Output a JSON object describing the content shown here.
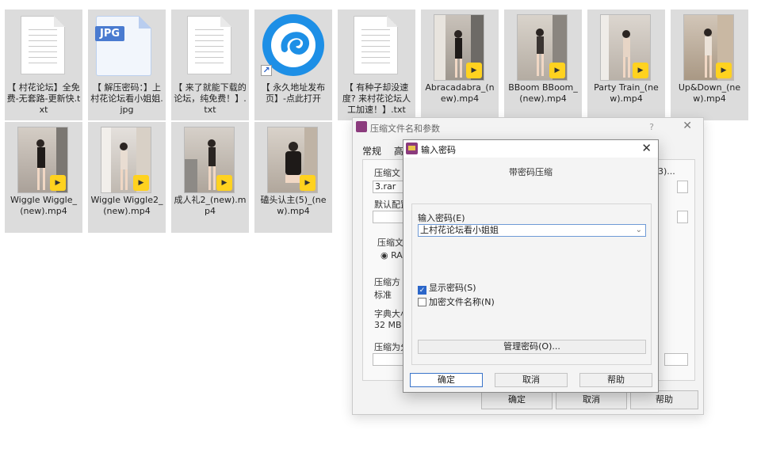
{
  "files": [
    {
      "name": "【 村花论坛】全免费-无套路-更新快.txt",
      "type": "txt"
    },
    {
      "name": "【 解压密码：】上村花论坛看小姐姐.jpg",
      "type": "jpg",
      "badge": "JPG"
    },
    {
      "name": "【 来了就能下载的论坛，纯免费！】.txt",
      "type": "txt"
    },
    {
      "name": "【 永久地址发布页】-点此打开",
      "type": "shortcut"
    },
    {
      "name": "【 有种子却没速度? 来村花论坛人工加速！】.txt",
      "type": "txt"
    },
    {
      "name": "Abracadabra_(new).mp4",
      "type": "video"
    },
    {
      "name": "BBoom BBoom_(new).mp4",
      "type": "video"
    },
    {
      "name": "Party Train_(new).mp4",
      "type": "video"
    },
    {
      "name": "Up&Down_(new).mp4",
      "type": "video"
    },
    {
      "name": "Wiggle Wiggle_(new).mp4",
      "type": "video"
    },
    {
      "name": "Wiggle Wiggle2_(new).mp4",
      "type": "video"
    },
    {
      "name": "成人礼2_(new).mp4",
      "type": "video"
    },
    {
      "name": "磕头认主(5)_(new).mp4",
      "type": "video"
    }
  ],
  "background_dialog": {
    "title": "压缩文件名和参数",
    "help_glyph": "?",
    "close_glyph": "✕",
    "tabs": [
      "常规",
      "高"
    ],
    "labels": {
      "archive_name": "压缩文",
      "archive_value": "3.rar",
      "browse_suffix": "3)...",
      "default_profile": "默认配置",
      "format": "压缩文",
      "format_option": "RAR",
      "method": "压缩方",
      "method_value": "标准",
      "dict": "字典大小",
      "dict_value": "32 MB",
      "split": "压缩为分"
    },
    "buttons": {
      "ok": "确定",
      "cancel": "取消",
      "help": "帮助"
    }
  },
  "password_dialog": {
    "title": "输入密码",
    "close_glyph": "✕",
    "header": "带密码压缩",
    "password_label": "输入密码(E)",
    "password_value": "上村花论坛看小姐姐",
    "dropdown_glyph": "⌄",
    "checkboxes": [
      {
        "label": "显示密码(S)",
        "checked": true
      },
      {
        "label": "加密文件名称(N)",
        "checked": false
      }
    ],
    "manage_button": "管理密码(O)...",
    "buttons": {
      "ok": "确定",
      "cancel": "取消",
      "help": "帮助"
    }
  },
  "icons": {
    "txt": "text-file-icon",
    "jpg": "image-file-icon",
    "shortcut": "shortcut-arrow-icon",
    "video": "video-thumbnail",
    "play": "media-player-icon",
    "winrar": "winrar-icon"
  }
}
